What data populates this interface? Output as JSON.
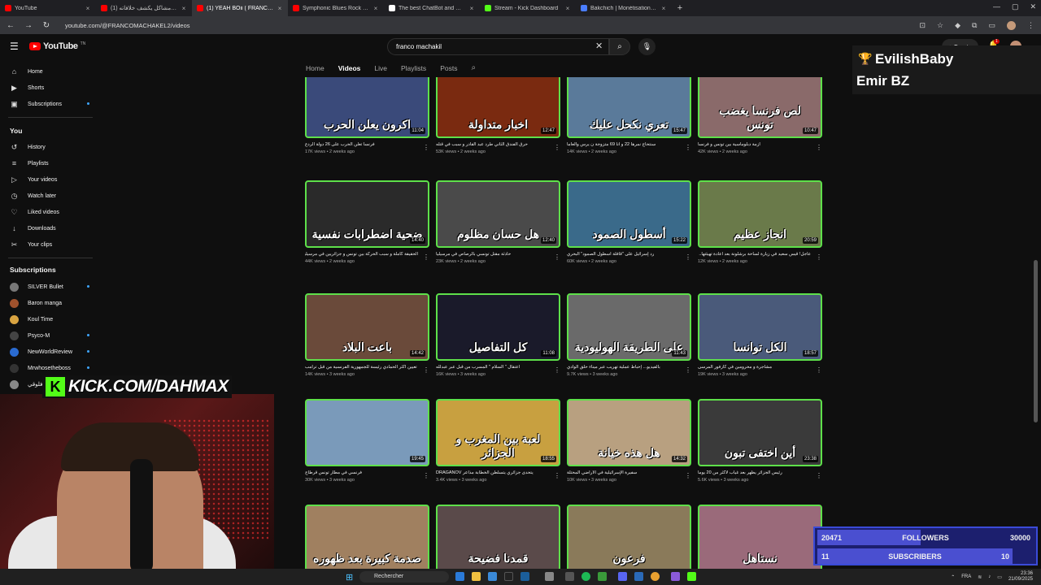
{
  "browser": {
    "tabs": [
      {
        "title": "YouTube",
        "color": "#ff0000",
        "active": false
      },
      {
        "title": "(1) فرانكو مشاكل يكشف خلافاته",
        "color": "#ff0000",
        "active": false
      },
      {
        "title": "(1) YEAH BOii ( FRANCO ) - You",
        "color": "#ff0000",
        "active": true
      },
      {
        "title": "Symphonic Blues Rock - Powe",
        "color": "#ff0000",
        "active": false
      },
      {
        "title": "The best ChatBot and Widgets",
        "color": "#ffffff",
        "active": false
      },
      {
        "title": "Stream - Kick Dashboard",
        "color": "#53fc18",
        "active": false
      },
      {
        "title": "Bakchich | Monétisation pour le",
        "color": "#4a7dff",
        "active": false
      }
    ],
    "url": "youtube.com/@FRANCOMACHAKEL2/videos"
  },
  "youtube": {
    "logo_text": "YouTube",
    "logo_sup": "TN",
    "search_value": "franco machakil",
    "create_label": "Create",
    "bell_badge": "1",
    "channel_tabs": [
      "Home",
      "Videos",
      "Live",
      "Playlists",
      "Posts"
    ],
    "active_tab": "Videos"
  },
  "sidebar": {
    "main": [
      {
        "label": "Home",
        "icon": "home-icon",
        "glyph": "⌂"
      },
      {
        "label": "Shorts",
        "icon": "shorts-icon",
        "glyph": "▶"
      },
      {
        "label": "Subscriptions",
        "icon": "subscriptions-icon",
        "glyph": "▣"
      }
    ],
    "you_header": "You",
    "you": [
      {
        "label": "History",
        "icon": "history-icon",
        "glyph": "↺"
      },
      {
        "label": "Playlists",
        "icon": "playlists-icon",
        "glyph": "≡"
      },
      {
        "label": "Your videos",
        "icon": "your-videos-icon",
        "glyph": "▷"
      },
      {
        "label": "Watch later",
        "icon": "watch-later-icon",
        "glyph": "◷"
      },
      {
        "label": "Liked videos",
        "icon": "liked-videos-icon",
        "glyph": "♡"
      },
      {
        "label": "Downloads",
        "icon": "downloads-icon",
        "glyph": "↓"
      },
      {
        "label": "Your clips",
        "icon": "clips-icon",
        "glyph": "✂"
      }
    ],
    "subs_header": "Subscriptions",
    "subs": [
      {
        "label": "SILVER Bullet",
        "color": "#777777"
      },
      {
        "label": "Baron manga",
        "color": "#a0522d"
      },
      {
        "label": "Koul Time",
        "color": "#d9a441"
      },
      {
        "label": "Psyco-M",
        "color": "#444444"
      },
      {
        "label": "NewWorldReview",
        "color": "#2a6bd1"
      },
      {
        "label": "Mrwhosetheboss",
        "color": "#333333"
      },
      {
        "label": "فلوقي",
        "color": "#888888"
      }
    ]
  },
  "videos": [
    {
      "thumb": "اكرون يعلن الحرب",
      "duration": "11:04",
      "title": "فرنسا تعلن الحرب على 26 دولة الردع",
      "meta": "17K views • 2 weeks ago",
      "bg": "#3a4a7a"
    },
    {
      "thumb": "اخبار متداولة",
      "duration": "12:47",
      "title": "حرق الفندق الثاني طرد عبد القادر و سبب في قتله",
      "meta": "53K views • 2 weeks ago",
      "bg": "#7a2a10"
    },
    {
      "thumb": "تعري نكحل عليك",
      "duration": "15:47",
      "title": "سنتحاج نمرها 22 و انا 69 متزوجة ن يرس والعاما",
      "meta": "14K views • 2 weeks ago",
      "bg": "#5a7a9a"
    },
    {
      "thumb": "لص فرنسا يغضب تونس",
      "duration": "10:47",
      "title": "ازمة دبلوماسية بين تونس و فرنسا",
      "meta": "42K views • 2 weeks ago",
      "bg": "#8a6a6a"
    },
    {
      "thumb": "ضحية اضطرابات نفسية",
      "duration": "14:40",
      "title": "الحقيقة كاملة و سبب الحركة بين تونس و جزائريين في مرسيليا",
      "meta": "44K views • 2 weeks ago",
      "bg": "#2a2a2a"
    },
    {
      "thumb": "هل حسان مظلوم",
      "duration": "12:40",
      "title": "حادثة مقتل تونسي بالرصاص في مرسيليا",
      "meta": "23K views • 2 weeks ago",
      "bg": "#4a4a4a"
    },
    {
      "thumb": "أسطول الصمود",
      "duration": "15:22",
      "title": "رد إسرائيل على \"قافلة أسطول الصمود\" البحري",
      "meta": "60K views • 2 weeks ago",
      "bg": "#3a6a8a"
    },
    {
      "thumb": "انجاز عظيم",
      "duration": "20:59",
      "title": "عاجل! قيس سعيد في زيارة لساحة برشلونة بعد اعادة تهيئتها.. الكبس يجيب",
      "meta": "12K views • 2 weeks ago",
      "bg": "#6a7a4a"
    },
    {
      "thumb": "باعت البلاد",
      "duration": "14:42",
      "title": "تعيين اكثر الحمادي رئيسة للجمهورية الفرنسية من قبل ترامب",
      "meta": "14K views • 3 weeks ago",
      "bg": "#6a4a3a"
    },
    {
      "thumb": "كل التفاصيل",
      "duration": "11:08",
      "title": "اعتقال \" السلام \" المسرب من قبل عبر عبدلله",
      "meta": "16K views • 3 weeks ago",
      "bg": "#1a1a2a"
    },
    {
      "thumb": "على الطريقة الهوليودية",
      "duration": "11:43",
      "title": "بالفيديو... إحباط عملية تهريب عبر ميناء حلق الوادي",
      "meta": "9.7K views • 3 weeks ago",
      "bg": "#6a6a6a"
    },
    {
      "thumb": "الكل توانسا",
      "duration": "18:57",
      "title": "مشاجرة و محرومين في كارفور المرسى",
      "meta": "19K views • 3 weeks ago",
      "bg": "#4a5a7a"
    },
    {
      "thumb": "",
      "duration": "19:45",
      "title": "فرنسي في مطار تونس قرطاج",
      "meta": "30K views • 3 weeks ago",
      "bg": "#7a9aba"
    },
    {
      "thumb": "لعبة بين المغرب و الجزائر",
      "duration": "18:55",
      "title": "يتحدى جزائري يتسلطن الخطابة مذاعر DRAGANOV",
      "meta": "3.4K views • 3 weeks ago",
      "bg": "#c8a040"
    },
    {
      "thumb": "هل هذه خيانة",
      "duration": "14:32",
      "title": "سفيرة الإسرائيلية في الاراضي المحتلة",
      "meta": "10K views • 3 weeks ago",
      "bg": "#b8a080"
    },
    {
      "thumb": "أين اختفى تبون",
      "duration": "23:38",
      "title": "رئيس الجزائر يظهر بعد غياب لأكثر من 20 يوما",
      "meta": "5.6K views • 3 weeks ago",
      "bg": "#3a3a3a"
    },
    {
      "thumb": "صدمة كبيرة بعد ظهوره",
      "duration": "",
      "title": "",
      "meta": "",
      "bg": "#a08060"
    },
    {
      "thumb": "قمدنا فضيحة",
      "duration": "",
      "title": "",
      "meta": "",
      "bg": "#5a4a4a"
    },
    {
      "thumb": "فرعون",
      "duration": "",
      "title": "",
      "meta": "",
      "bg": "#8a7a5a"
    },
    {
      "thumb": "نستاهل",
      "duration": "",
      "title": "",
      "meta": "",
      "bg": "#9a6a7a"
    }
  ],
  "overlay": {
    "name1": "EvilishBaby",
    "name2": "Emir BZ",
    "kick_text": "KICK.COM/DAHMAX",
    "kick_letter": "K",
    "followers_current": "20471",
    "followers_label": "FOLLOWERS",
    "followers_goal": "30000",
    "followers_progress": 0.68,
    "subs_current": "11",
    "subs_label": "SUBSCRIBERS",
    "subs_goal": "10",
    "subs_progress": 1.0
  },
  "taskbar": {
    "search_label": "Rechercher",
    "lang": "FRA",
    "time": "23:36",
    "date": "21/09/2025"
  }
}
